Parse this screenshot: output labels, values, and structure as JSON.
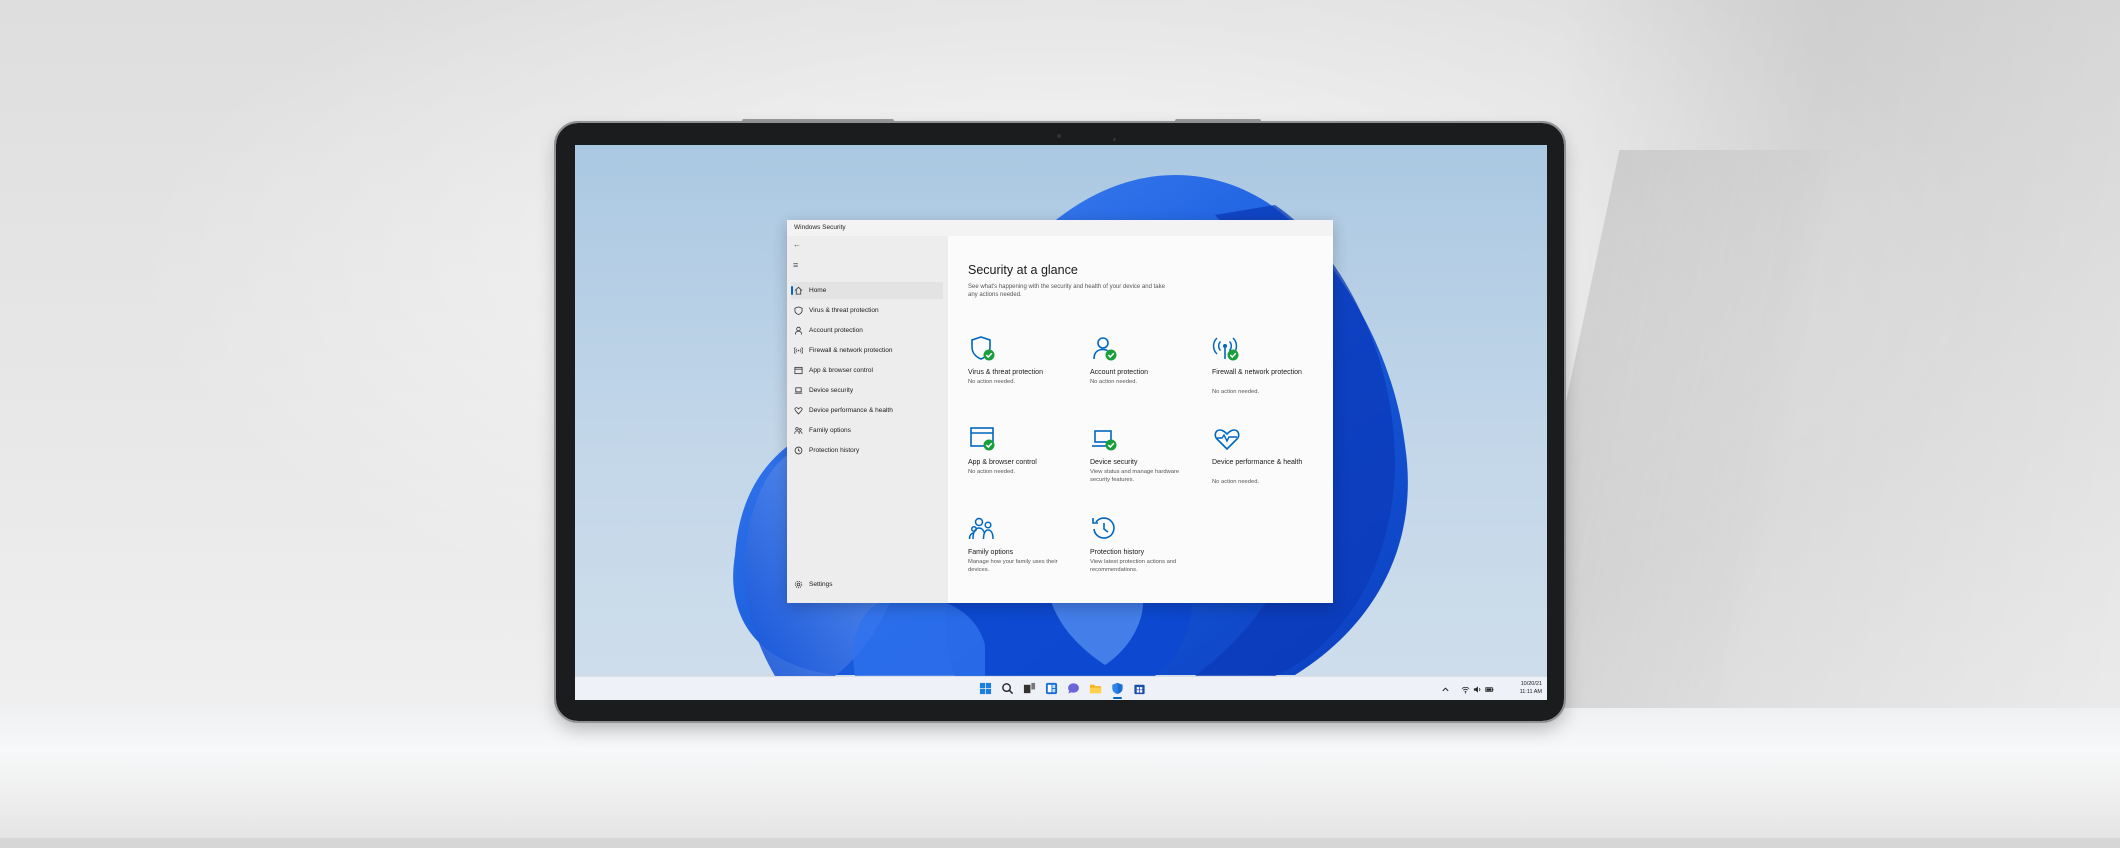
{
  "window": {
    "title": "Windows Security"
  },
  "nav": {
    "back_icon": "back-arrow-icon",
    "menu_icon": "hamburger-menu-icon",
    "items": [
      {
        "label": "Home",
        "icon": "home-icon",
        "active": true
      },
      {
        "label": "Virus & threat protection",
        "icon": "shield-icon"
      },
      {
        "label": "Account protection",
        "icon": "person-icon"
      },
      {
        "label": "Firewall & network protection",
        "icon": "wifi-antenna-icon"
      },
      {
        "label": "App & browser control",
        "icon": "app-window-icon"
      },
      {
        "label": "Device security",
        "icon": "laptop-icon"
      },
      {
        "label": "Device performance & health",
        "icon": "heart-icon"
      },
      {
        "label": "Family options",
        "icon": "family-icon"
      },
      {
        "label": "Protection history",
        "icon": "history-icon"
      }
    ],
    "settings_label": "Settings",
    "settings_icon": "gear-icon"
  },
  "main": {
    "title": "Security at a glance",
    "subtitle": "See what's happening with the security and health of your device and take any actions needed.",
    "tiles": [
      {
        "title": "Virus & threat protection",
        "status": "No action needed.",
        "icon": "shield-check-icon"
      },
      {
        "title": "Account protection",
        "status": "No action needed.",
        "icon": "person-check-icon"
      },
      {
        "title": "Firewall & network protection",
        "status": "No action needed.",
        "icon": "antenna-check-icon"
      },
      {
        "title": "App & browser control",
        "status": "No action needed.",
        "icon": "window-check-icon"
      },
      {
        "title": "Device security",
        "status": "View status and manage hardware security features.",
        "icon": "laptop-check-icon"
      },
      {
        "title": "Device performance & health",
        "status": "No action needed.",
        "icon": "heart-pulse-icon"
      },
      {
        "title": "Family options",
        "status": "Manage how your family uses their devices.",
        "icon": "family-icon"
      },
      {
        "title": "Protection history",
        "status": "View latest protection actions and recommendations.",
        "icon": "history-icon"
      }
    ]
  },
  "taskbar": {
    "icons": [
      "start-icon",
      "search-icon",
      "task-view-icon",
      "widgets-icon",
      "chat-icon",
      "file-explorer-icon",
      "windows-security-icon",
      "store-icon"
    ],
    "tray_icons": [
      "chevron-up-icon",
      "wifi-icon",
      "volume-icon",
      "battery-icon"
    ],
    "date": "10/20/21",
    "time": "11:11 AM"
  },
  "colors": {
    "accent": "#0067c0",
    "status_ok": "#1a9e3c",
    "bloom": "#1f66e5"
  }
}
